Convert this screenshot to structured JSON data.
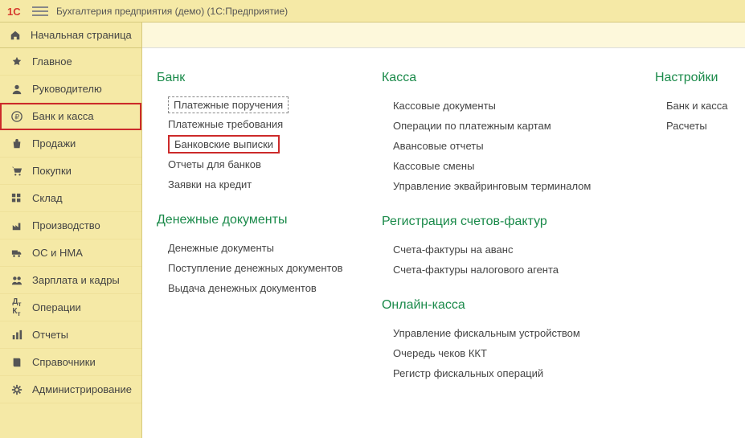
{
  "titlebar": {
    "title": "Бухгалтерия предприятия (демо)  (1С:Предприятие)"
  },
  "sidebar": {
    "home": "Начальная страница",
    "items": [
      {
        "icon": "star",
        "label": "Главное"
      },
      {
        "icon": "user",
        "label": "Руководителю"
      },
      {
        "icon": "ruble",
        "label": "Банк и касса",
        "selected": true
      },
      {
        "icon": "bag",
        "label": "Продажи"
      },
      {
        "icon": "cart",
        "label": "Покупки"
      },
      {
        "icon": "grid",
        "label": "Склад"
      },
      {
        "icon": "factory",
        "label": "Производство"
      },
      {
        "icon": "truck",
        "label": "ОС и НМА"
      },
      {
        "icon": "people",
        "label": "Зарплата и кадры"
      },
      {
        "icon": "dtkt",
        "label": "Операции"
      },
      {
        "icon": "chart",
        "label": "Отчеты"
      },
      {
        "icon": "book",
        "label": "Справочники"
      },
      {
        "icon": "gear",
        "label": "Администрирование"
      }
    ]
  },
  "content": {
    "columns": [
      {
        "sections": [
          {
            "title": "Банк",
            "items": [
              {
                "label": "Платежные поручения",
                "style": "box-dashed"
              },
              {
                "label": "Платежные требования"
              },
              {
                "label": "Банковские выписки",
                "style": "box-red"
              },
              {
                "label": "Отчеты для банков"
              },
              {
                "label": "Заявки на кредит"
              }
            ]
          },
          {
            "title": "Денежные документы",
            "items": [
              {
                "label": "Денежные документы"
              },
              {
                "label": "Поступление денежных документов"
              },
              {
                "label": "Выдача денежных документов"
              }
            ]
          }
        ]
      },
      {
        "sections": [
          {
            "title": "Касса",
            "items": [
              {
                "label": "Кассовые документы"
              },
              {
                "label": "Операции по платежным картам"
              },
              {
                "label": "Авансовые отчеты"
              },
              {
                "label": "Кассовые смены"
              },
              {
                "label": "Управление эквайринговым терминалом"
              }
            ]
          },
          {
            "title": "Регистрация счетов-фактур",
            "items": [
              {
                "label": "Счета-фактуры на аванс"
              },
              {
                "label": "Счета-фактуры налогового агента"
              }
            ]
          },
          {
            "title": "Онлайн-касса",
            "items": [
              {
                "label": "Управление фискальным устройством"
              },
              {
                "label": "Очередь чеков ККТ"
              },
              {
                "label": "Регистр фискальных операций"
              }
            ]
          }
        ]
      },
      {
        "sections": [
          {
            "title": "Настройки",
            "items": [
              {
                "label": "Банк и касса"
              },
              {
                "label": "Расчеты"
              }
            ]
          }
        ]
      }
    ]
  }
}
